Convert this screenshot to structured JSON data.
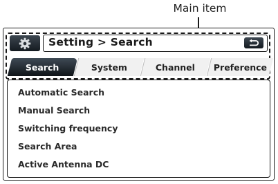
{
  "annotation": {
    "label": "Main item"
  },
  "header": {
    "icon": "gear-icon",
    "breadcrumb": "Setting > Search",
    "back_icon": "return-arrow-icon"
  },
  "tabs": [
    {
      "label": "Search",
      "active": true
    },
    {
      "label": "System",
      "active": false
    },
    {
      "label": "Channel",
      "active": false
    },
    {
      "label": "Preference",
      "active": false
    }
  ],
  "menu": {
    "items": [
      {
        "label": "Automatic Search"
      },
      {
        "label": "Manual Search"
      },
      {
        "label": "Switching frequency"
      },
      {
        "label": "Search Area"
      },
      {
        "label": "Active Antenna DC"
      }
    ]
  },
  "colors": {
    "button_dark": "#1d242b",
    "frame": "#1a1a1a",
    "tab_inactive": "#f1f1f1"
  }
}
